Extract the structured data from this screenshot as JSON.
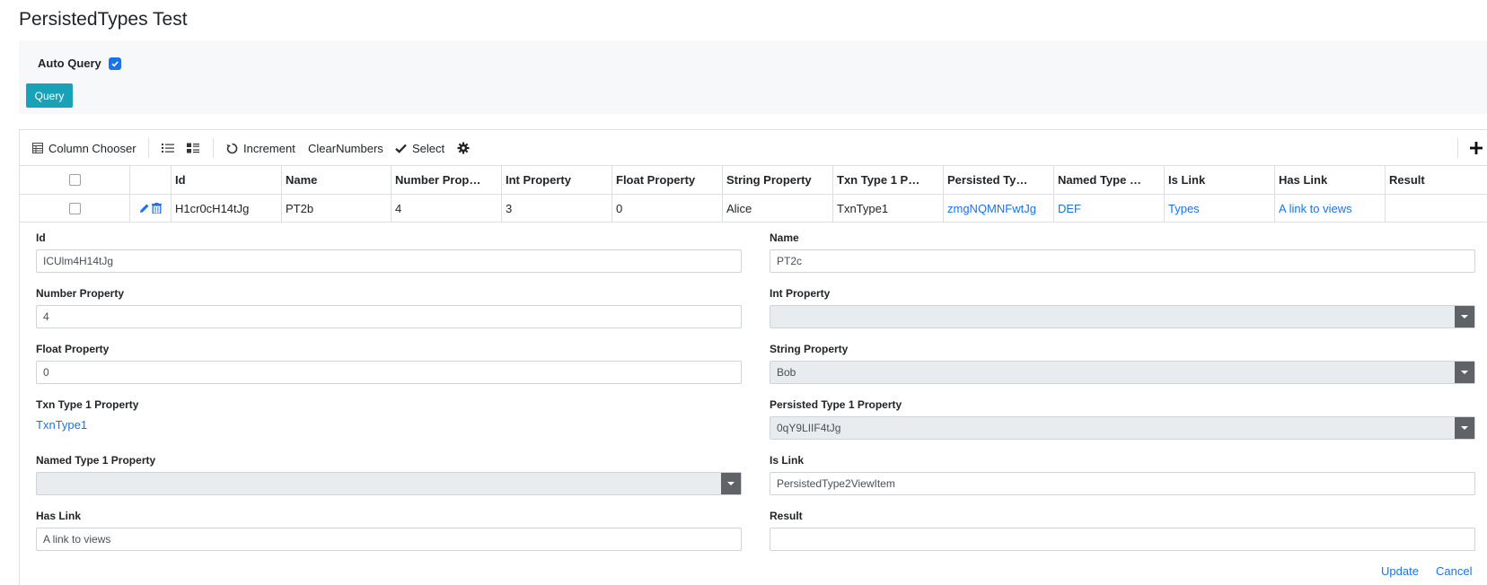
{
  "page": {
    "title": "PersistedTypes Test"
  },
  "query_panel": {
    "auto_query_label": "Auto Query",
    "auto_query_checked": true,
    "query_button": "Query"
  },
  "toolbar": {
    "column_chooser": "Column Chooser",
    "increment": "Increment",
    "clear_numbers": "ClearNumbers",
    "select": "Select",
    "add_icon": "plus-icon"
  },
  "columns": [
    "",
    "",
    "Id",
    "Name",
    "Number Prop…",
    "Int Property",
    "Float Property",
    "String Property",
    "Txn Type 1 P…",
    "Persisted Ty…",
    "Named Type …",
    "Is Link",
    "Has Link",
    "Result"
  ],
  "row": {
    "id": "H1cr0cH14tJg",
    "name": "PT2b",
    "number": "4",
    "int": "3",
    "float": "0",
    "string": "Alice",
    "txn": "TxnType1",
    "persisted": "zmgNQMNFwtJg",
    "named": "DEF",
    "is_link": "Types",
    "has_link": "A link to views",
    "result": ""
  },
  "form": {
    "id": {
      "label": "Id",
      "value": "ICUlm4H14tJg"
    },
    "name": {
      "label": "Name",
      "value": "PT2c"
    },
    "number": {
      "label": "Number Property",
      "value": "4"
    },
    "int": {
      "label": "Int Property",
      "value": ""
    },
    "float": {
      "label": "Float Property",
      "value": "0"
    },
    "string": {
      "label": "String Property",
      "value": "Bob"
    },
    "txn": {
      "label": "Txn Type 1 Property",
      "value": "TxnType1"
    },
    "persisted": {
      "label": "Persisted Type 1 Property",
      "value": "0qY9LIIF4tJg"
    },
    "named": {
      "label": "Named Type 1 Property",
      "value": ""
    },
    "is_link": {
      "label": "Is Link",
      "value": "PersistedType2ViewItem"
    },
    "has_link": {
      "label": "Has Link",
      "value": "A link to views"
    },
    "result": {
      "label": "Result",
      "value": ""
    },
    "update": "Update",
    "cancel": "Cancel"
  },
  "colors": {
    "accent": "#1a73e8",
    "query_button": "#17a2b8",
    "panel_bg": "#f7f8fa",
    "dropdown_btn": "#5f6368"
  }
}
